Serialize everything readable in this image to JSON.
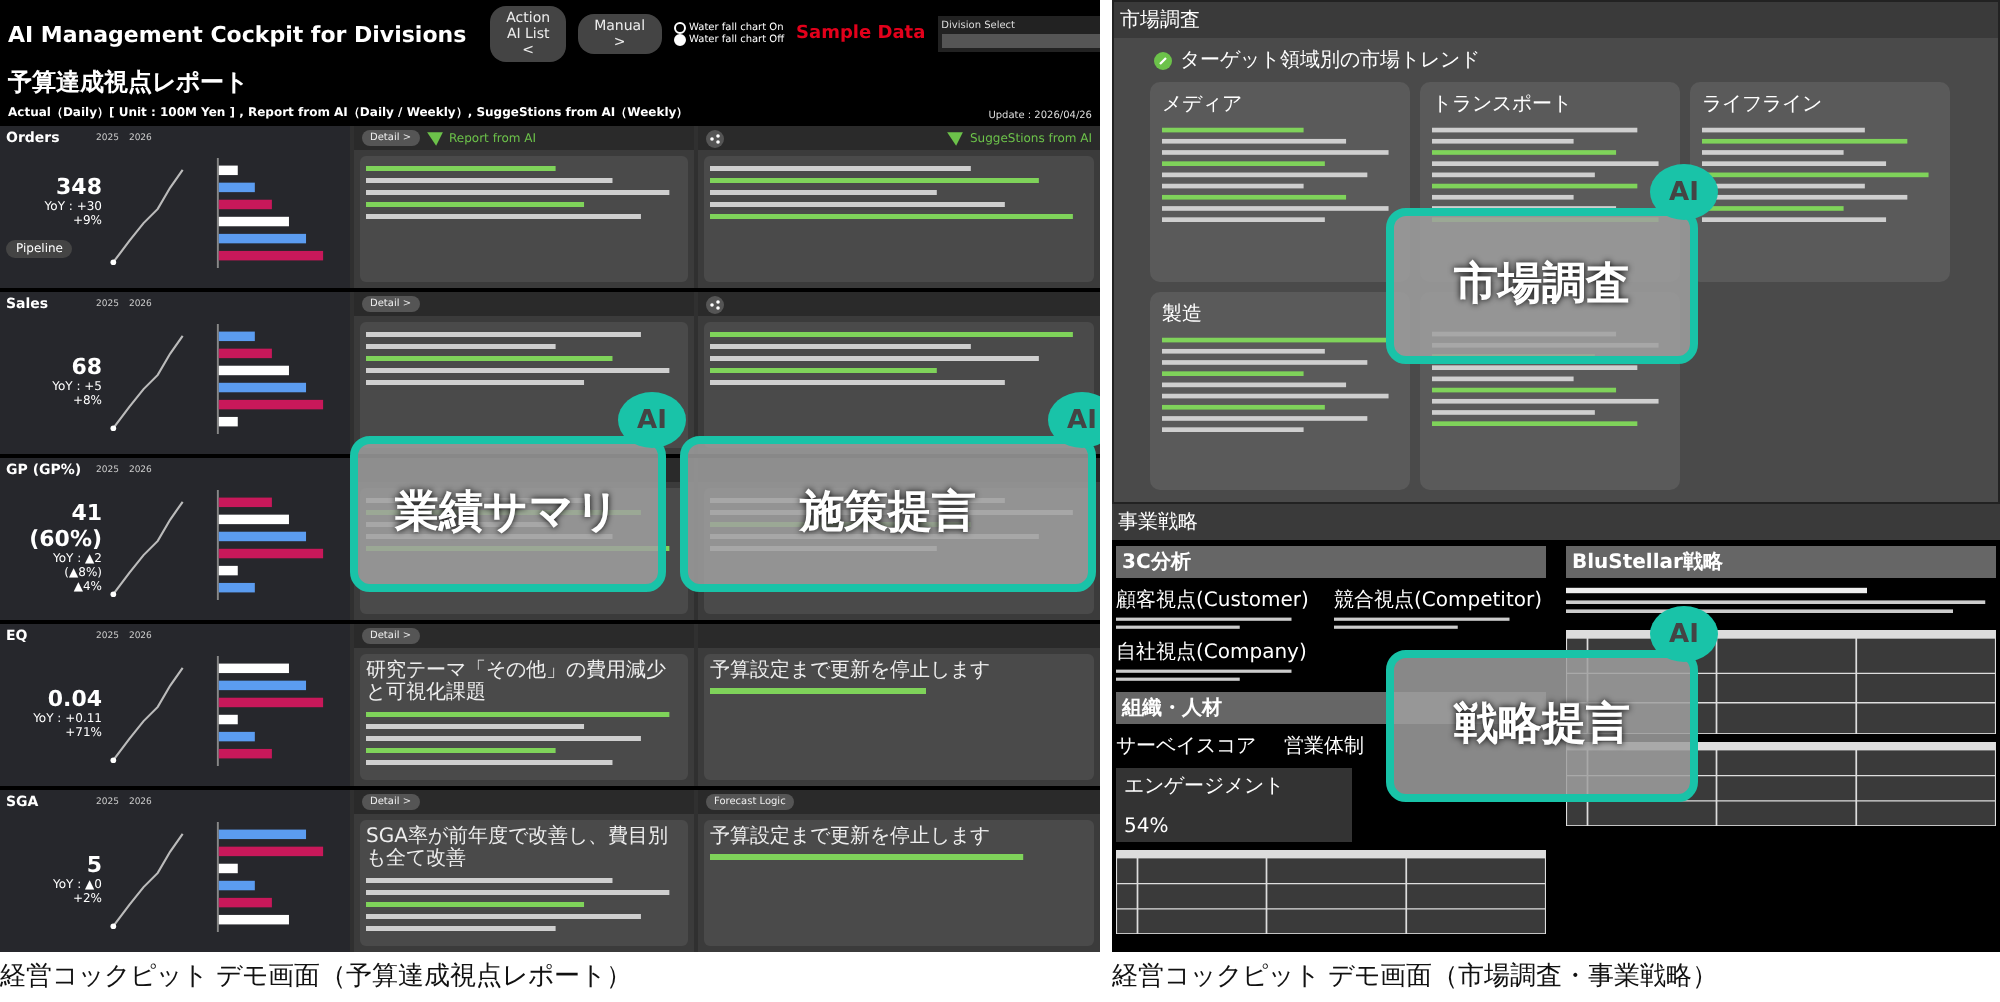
{
  "left": {
    "title": "AI Management Cockpit for Divisions",
    "buttons": [
      {
        "label": "Action AI List <"
      },
      {
        "label": "Manual >"
      }
    ],
    "radios": [
      {
        "label": "Water fall chart On",
        "selected": false
      },
      {
        "label": "Water fall chart Off",
        "selected": true
      }
    ],
    "sample_label": "Sample Data",
    "division_select": {
      "label": "Division Select"
    },
    "report_title": "予算達成視点レポート",
    "subtitle": "Actual（Daily）[ Unit : 100M Yen ] , Report from AI（Daily / Weekly）, SuggeStions from AI（Weekly）",
    "update": "Update : 2026/04/26",
    "report_header": "Report from AI",
    "suggestion_header": "SuggeStions from AI",
    "metrics": [
      {
        "name": "Orders",
        "legend": [
          "2025",
          "2026"
        ],
        "value": [
          "348"
        ],
        "yoy": [
          "YoY : +30",
          "+9%"
        ],
        "button": "Pipeline",
        "detail": "Detail >"
      },
      {
        "name": "Sales",
        "legend": [
          "2025",
          "2026"
        ],
        "value": [
          "68"
        ],
        "yoy": [
          "YoY : +5",
          "+8%"
        ],
        "detail": "Detail >"
      },
      {
        "name": "GP (GP%)",
        "legend": [
          "2025",
          "2026"
        ],
        "value": [
          "41",
          "(60%)"
        ],
        "yoy": [
          "YoY : ▲2",
          "(▲8%)",
          "▲4%"
        ]
      },
      {
        "name": "EQ",
        "legend": [
          "2025",
          "2026"
        ],
        "value": [
          "0.04"
        ],
        "yoy": [
          "YoY : +0.11",
          "+71%"
        ],
        "detail": "Detail >",
        "summary_title": "研究テーマ「その他」の費用減少と可視化課題",
        "suggestion_title": "予算設定まで更新を停止します"
      },
      {
        "name": "SGA",
        "legend": [
          "2025",
          "2026"
        ],
        "value": [
          "5"
        ],
        "yoy": [
          "YoY : ▲0",
          "+2%"
        ],
        "detail": "Detail >",
        "summary_title": "SGA率が前年度で改善し、費目別も全て改善",
        "suggestion_title": "予算設定まで更新を停止します",
        "extra_button": "Forecast Logic"
      }
    ],
    "overlays": [
      {
        "label": "業績サマリ",
        "badge": "AI"
      },
      {
        "label": "施策提言",
        "badge": "AI"
      }
    ],
    "caption": "経営コックピット デモ画面（予算達成視点レポート）"
  },
  "right": {
    "market": {
      "header": "市場調査",
      "subtitle": "ターゲット領域別の市場トレンド",
      "cards": [
        {
          "kind": "titled",
          "title": "メディア"
        },
        {
          "kind": "titled",
          "title": "トランスポート"
        },
        {
          "kind": "titled",
          "title": "ライフライン"
        },
        {
          "kind": "titled",
          "title": "製造"
        },
        {
          "kind": "untitled"
        }
      ]
    },
    "strategy": {
      "header": "事業戦略",
      "sections": [
        {
          "title": "3C分析"
        },
        {
          "title": "BluStellar戦略"
        }
      ],
      "three_c": [
        "顧客視点(Customer)",
        "競合視点(Competitor)",
        "自社視点(Company)"
      ],
      "org_title": "組織・人材",
      "survey_title": "サーベイスコア",
      "engagement": "エンゲージメント",
      "engagement_value": "54%",
      "sales_title": "営業体制"
    },
    "overlays": [
      {
        "label": "市場調査",
        "badge": "AI"
      },
      {
        "label": "戦略提言",
        "badge": "AI"
      }
    ],
    "caption": "経営コックピット デモ画面（市場調査・事業戦略）"
  }
}
